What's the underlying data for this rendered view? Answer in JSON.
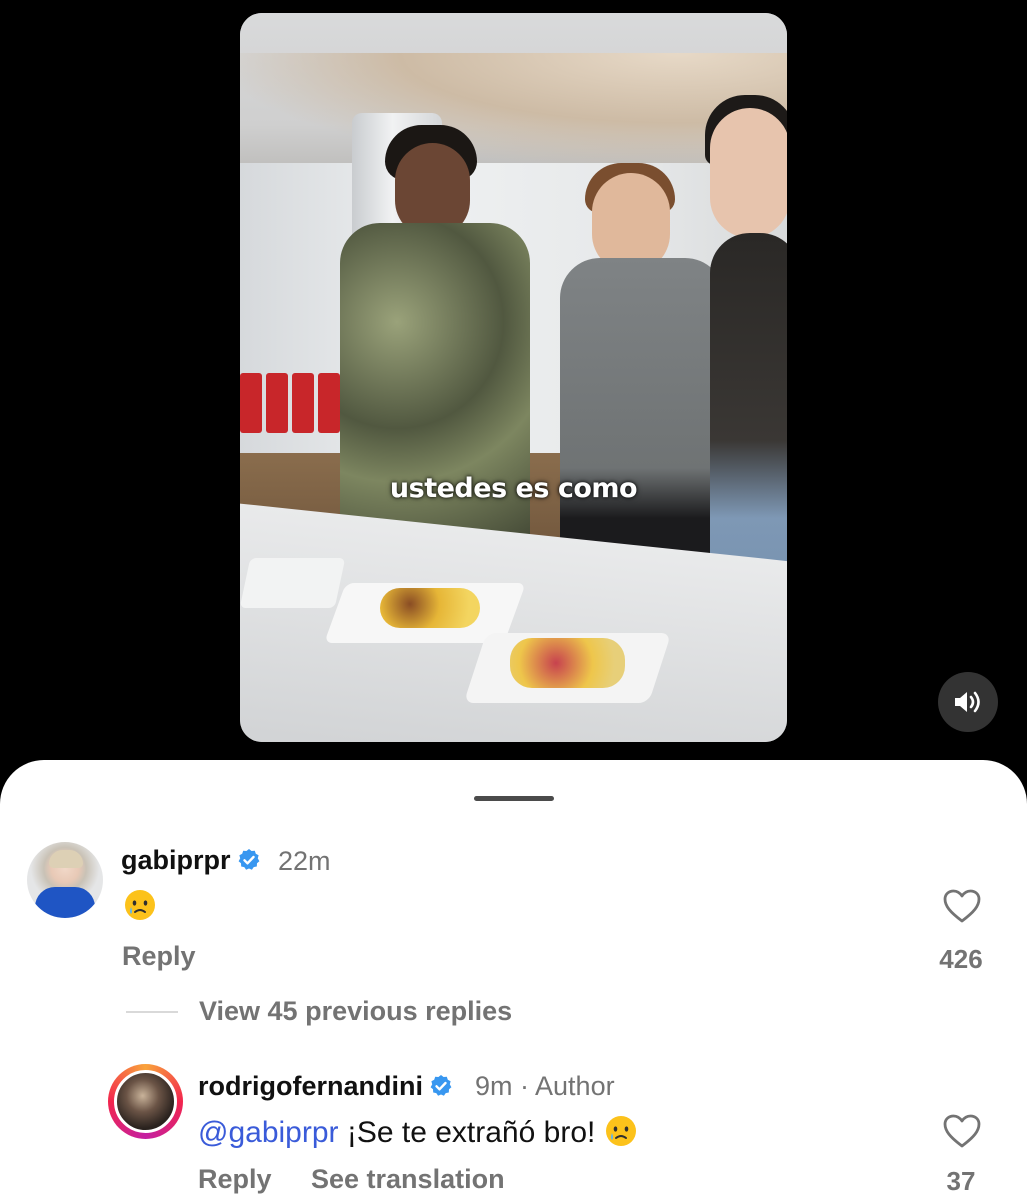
{
  "video": {
    "caption": "ustedes es como",
    "mute_icon": "speaker-icon"
  },
  "comments": {
    "top": {
      "username": "gabiprpr",
      "verified": true,
      "time": "22m",
      "emoji": "crying-face",
      "reply_label": "Reply",
      "like_count": "426"
    },
    "view_previous": "View 45 previous replies",
    "reply": {
      "username": "rodrigofernandini",
      "verified": true,
      "time": "9m",
      "separator": " · ",
      "author_label": "Author",
      "mention": "@gabiprpr",
      "text": " ¡Se te extrañó bro! ",
      "emoji": "crying-face",
      "reply_label": "Reply",
      "translate_label": "See translation",
      "like_count": "37"
    }
  },
  "colors": {
    "accent_blue": "#3a5bd9",
    "verified_blue": "#3897f0",
    "muted_text": "#737373"
  }
}
